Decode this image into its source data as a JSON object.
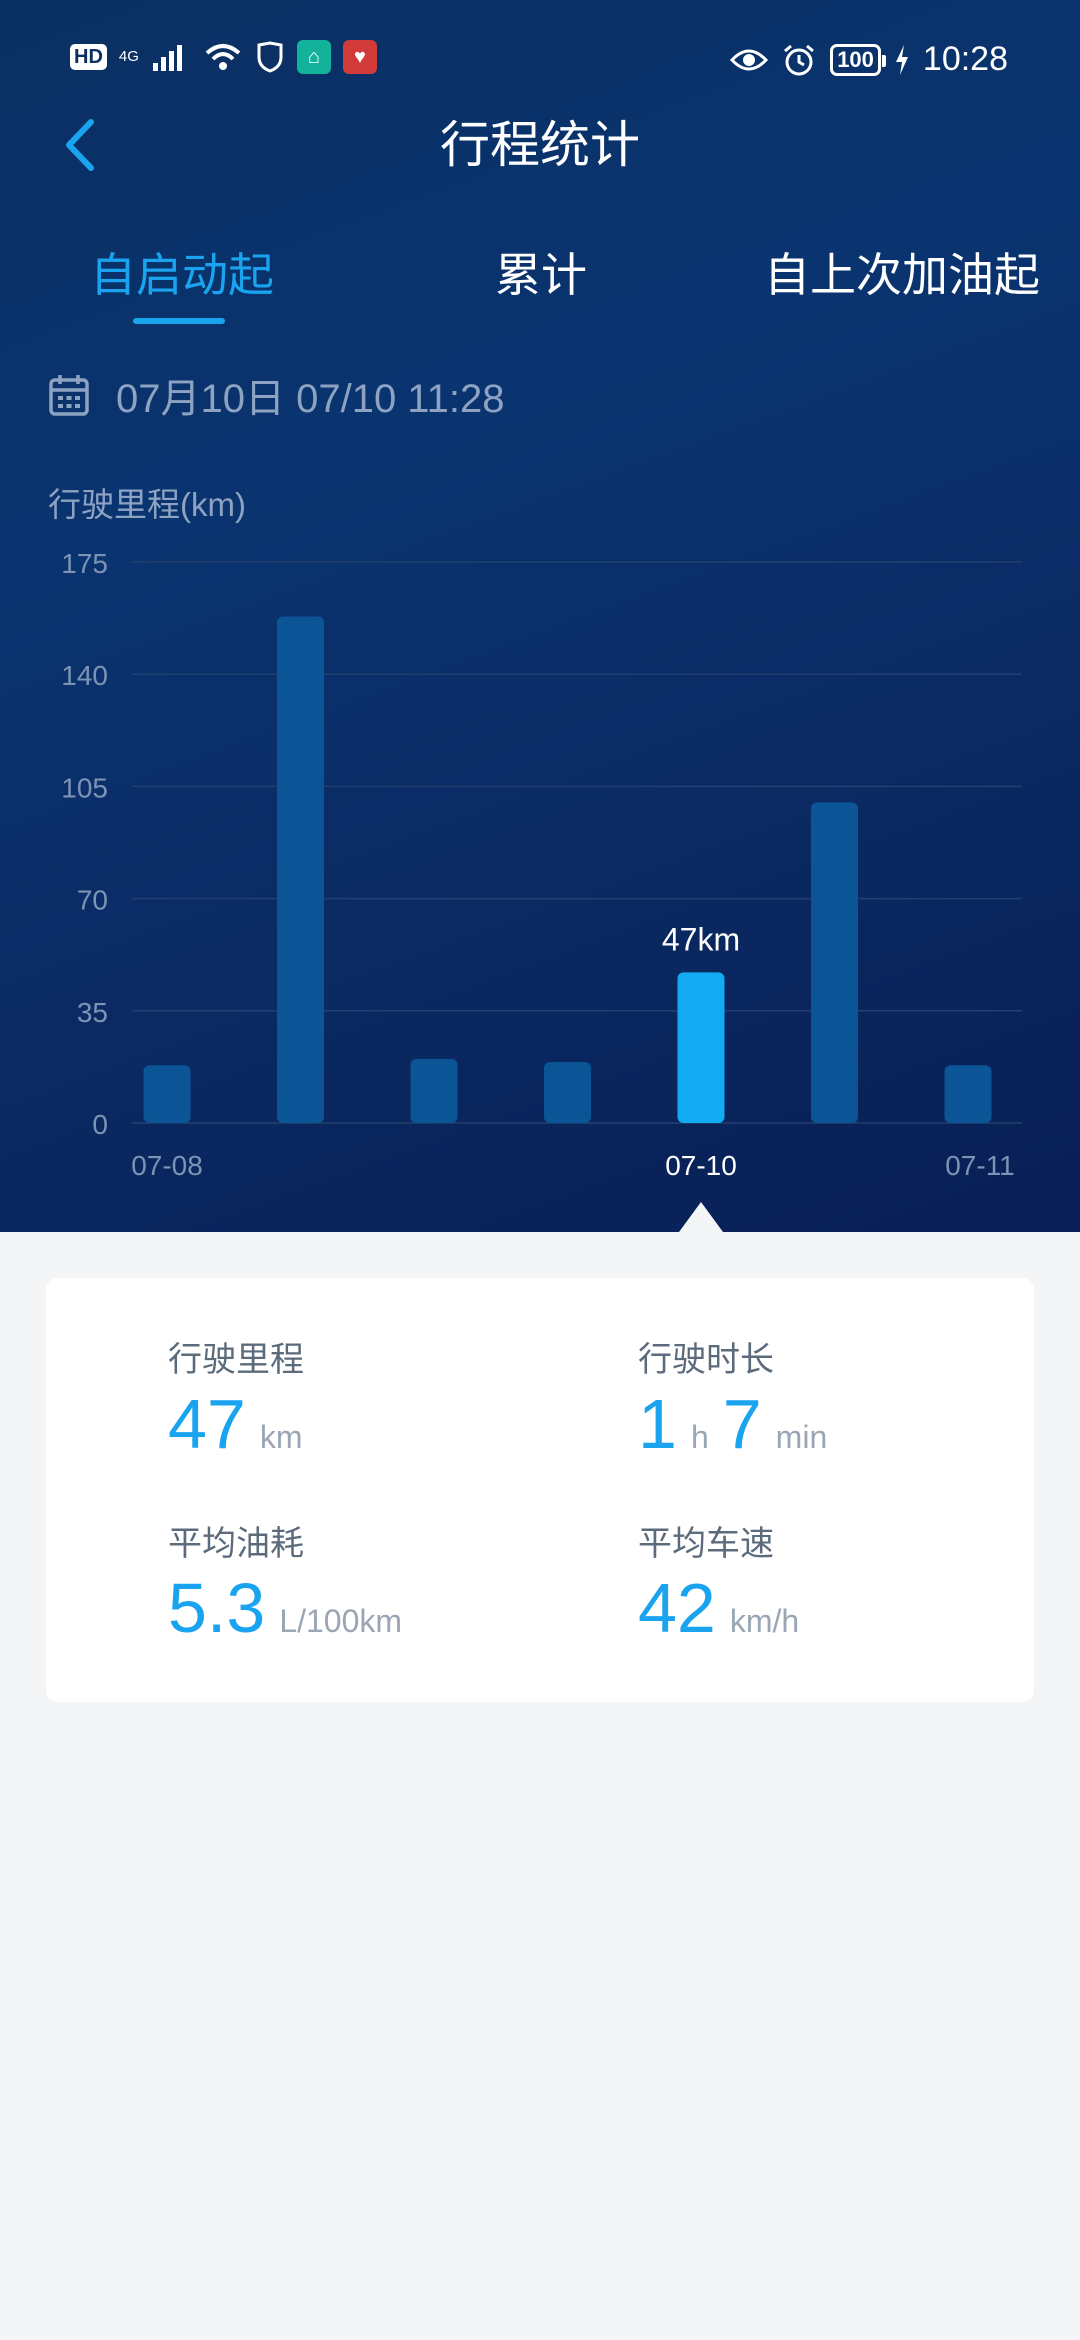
{
  "status_bar": {
    "hd": "HD",
    "network": "4G",
    "time": "10:28",
    "battery": "100"
  },
  "header": {
    "title": "行程统计"
  },
  "tabs": [
    {
      "label": "自启动起",
      "active": true
    },
    {
      "label": "累计",
      "active": false
    },
    {
      "label": "自上次加油起",
      "active": false
    }
  ],
  "date_text": "07月10日 07/10 11:28",
  "chart_data": {
    "type": "bar",
    "ylabel": "行驶里程(km)",
    "ylim": [
      0,
      175
    ],
    "yticks": [
      "175",
      "140",
      "105",
      "70",
      "35",
      "0"
    ],
    "values": [
      18,
      158,
      20,
      19,
      47,
      100,
      18
    ],
    "selected_index": 4,
    "selected_label": "47km",
    "x_tick_labels": [
      {
        "index": 0,
        "label": "07-08"
      },
      {
        "index": 4,
        "label": "07-10"
      },
      {
        "index": 6,
        "label": "07-11"
      }
    ],
    "colors": {
      "bar": "#0b5596",
      "selected_bar": "#12aaf0",
      "grid": "#22406f",
      "tick": "#7c93b6",
      "selected_tick": "#ffffff"
    }
  },
  "stats": {
    "mileage": {
      "label": "行驶里程",
      "value": "47",
      "unit": "km"
    },
    "duration": {
      "label": "行驶时长",
      "hours": "1",
      "hours_unit": "h",
      "minutes": "7",
      "minutes_unit": "min"
    },
    "fuel": {
      "label": "平均油耗",
      "value": "5.3",
      "unit": "L/100km"
    },
    "speed": {
      "label": "平均车速",
      "value": "42",
      "unit": "km/h"
    }
  }
}
